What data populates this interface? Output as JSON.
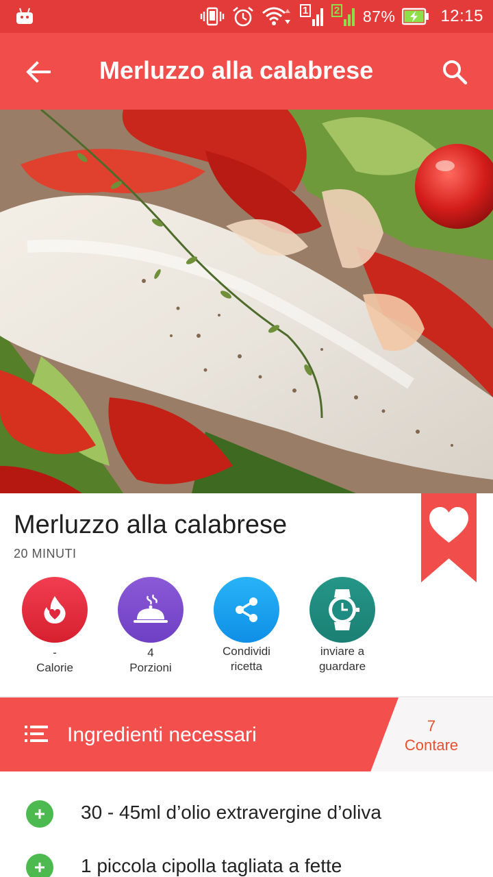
{
  "status_bar": {
    "battery_percent": "87%",
    "time": "12:15",
    "sim1_label": "1",
    "sim2_label": "2",
    "icons": [
      "android-icon",
      "vibrate-icon",
      "alarm-icon",
      "wifi-icon",
      "signal-sim1-icon",
      "signal-sim2-icon",
      "battery-charging-icon"
    ]
  },
  "app_bar": {
    "title": "Merluzzo alla calabrese",
    "back_icon": "arrow-back-icon",
    "search_icon": "search-icon"
  },
  "hero": {
    "image": "photo of cod fillet with peppers, tomatoes and thyme"
  },
  "recipe": {
    "title": "Merluzzo alla calabrese",
    "time": "20 MINUTI",
    "bookmark_icon": "heart-icon"
  },
  "actions": [
    {
      "value": "-",
      "label": "Calorie",
      "icon": "flame-heart-icon",
      "color": "#e0283e"
    },
    {
      "value": "4",
      "label": "Porzioni",
      "icon": "serving-cloche-icon",
      "color": "#7e4fd0"
    },
    {
      "line1": "Condividi",
      "line2": "ricetta",
      "icon": "share-icon",
      "color": "#1ea1f3"
    },
    {
      "line1": "inviare a",
      "line2": "guardare",
      "icon": "watch-icon",
      "color": "#1f8c82"
    }
  ],
  "ingredients": {
    "title": "Ingredienti necessari",
    "count": "7",
    "count_label": "Contare",
    "items": [
      "30 - 45ml d’olio extravergine d’oliva",
      "1 piccola cipolla tagliata a fette"
    ]
  },
  "colors": {
    "status_bar": "#e23b39",
    "app_bar": "#f14d4b",
    "band_red": "#f24f4d",
    "count_text": "#e8502e",
    "plus_green": "#4cba4f"
  }
}
